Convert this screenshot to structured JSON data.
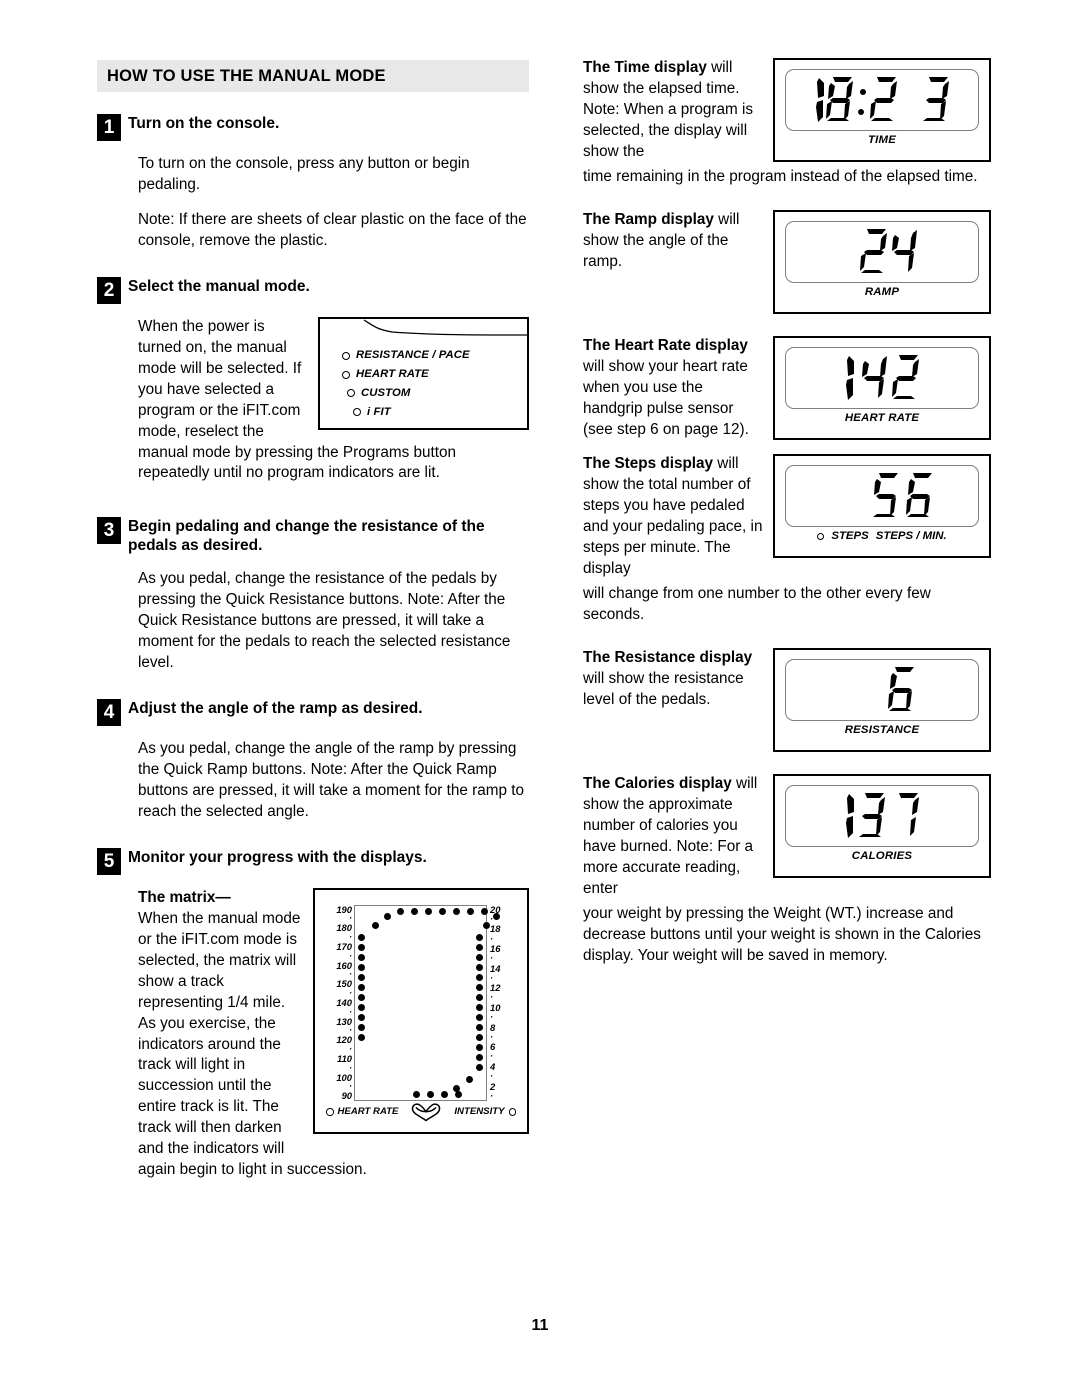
{
  "header": {
    "title": "HOW TO USE THE MANUAL MODE"
  },
  "page_number": "11",
  "steps": [
    {
      "number": "1",
      "title": "Turn on the console.",
      "paragraphs": [
        "To turn on the console, press any button or begin pedaling.",
        "Note: If there are sheets of clear plastic on the face of the console, remove the plastic."
      ]
    },
    {
      "number": "2",
      "title": "Select the manual mode.",
      "wrap_text": "When the power is turned on, the manual mode will be selected. If you have selected a program or the iFIT.com mode, reselect the manual mode by pressing the Programs button repeatedly until no program indicators are lit."
    },
    {
      "number": "3",
      "title": "Begin pedaling and change the resistance of the pedals as desired.",
      "paragraphs": [
        "As you pedal, change the resistance of the pedals by pressing the Quick Resistance buttons. Note: After the Quick Resistance buttons are pressed, it will take a moment for the pedals to reach the selected resistance level."
      ]
    },
    {
      "number": "4",
      "title": "Adjust the angle of the ramp as desired.",
      "paragraphs": [
        "As you pedal, change the angle of the ramp by pressing the Quick Ramp buttons. Note: After the Quick Ramp buttons are pressed, it will take a moment for the ramp to reach the selected angle."
      ]
    },
    {
      "number": "5",
      "title": "Monitor your progress with the displays.",
      "matrix_heading": "The matrix—",
      "matrix_text": "When the manual mode or the iFIT.com mode is selected, the matrix will show a track representing 1/4 mile. As you exercise, the indicators around the track will light in succession until the entire track is lit. The track will then darken and the indicators will again begin to light in succession."
    }
  ],
  "console_panel": {
    "indicators": [
      "RESISTANCE / PACE",
      "HEART RATE",
      "CUSTOM",
      "i FIT"
    ]
  },
  "matrix": {
    "left_axis": [
      "190",
      "·",
      "180",
      "·",
      "170",
      "·",
      "160",
      "·",
      "150",
      "·",
      "140",
      "·",
      "130",
      "·",
      "120",
      "·",
      "110",
      "·",
      "100",
      "·",
      "90"
    ],
    "right_axis": [
      "20",
      "·",
      "18",
      "·",
      "16",
      "·",
      "14",
      "·",
      "12",
      "·",
      "10",
      "·",
      "8",
      "·",
      "6",
      "·",
      "4",
      "·",
      "2",
      "·"
    ],
    "footer_left": "HEART RATE",
    "footer_right": "INTENSITY"
  },
  "displays": [
    {
      "key": "time",
      "title": "The Time display",
      "title_rest": " will show the elapsed time. Note: When a program is selected, the display will show the",
      "overflow": "time remaining in the program instead of the elapsed time.",
      "value": "18:23",
      "label": "TIME"
    },
    {
      "key": "ramp",
      "title": "The Ramp display",
      "title_rest": " will show the angle of the ramp.",
      "value": "24",
      "label": "RAMP"
    },
    {
      "key": "heart_rate",
      "title": "The Heart Rate display",
      "title_rest": " will show your heart rate when you use the handgrip pulse sensor (see step 6 on page 12).",
      "value": "142",
      "label": "HEART RATE"
    },
    {
      "key": "steps",
      "title": "The Steps display",
      "title_rest": " will show the total number of steps you have pedaled and your pedaling pace, in steps per minute. The display",
      "overflow": "will change from one number to the other every few seconds.",
      "value": "56",
      "label": "STEPS",
      "label2": "STEPS / MIN."
    },
    {
      "key": "resistance",
      "title": "The Resistance display",
      "title_rest": " will show the resistance level of the pedals.",
      "value": "6",
      "label": "RESISTANCE"
    },
    {
      "key": "calories",
      "title": "The Calories display",
      "title_rest": " will show the approximate number of calories you have burned. Note: For a more accurate reading, enter",
      "overflow": "your weight by pressing the Weight (WT.) increase and decrease buttons until your weight is shown in the Calories display. Your weight will be saved in memory.",
      "value": "137",
      "label": "CALORIES"
    }
  ]
}
